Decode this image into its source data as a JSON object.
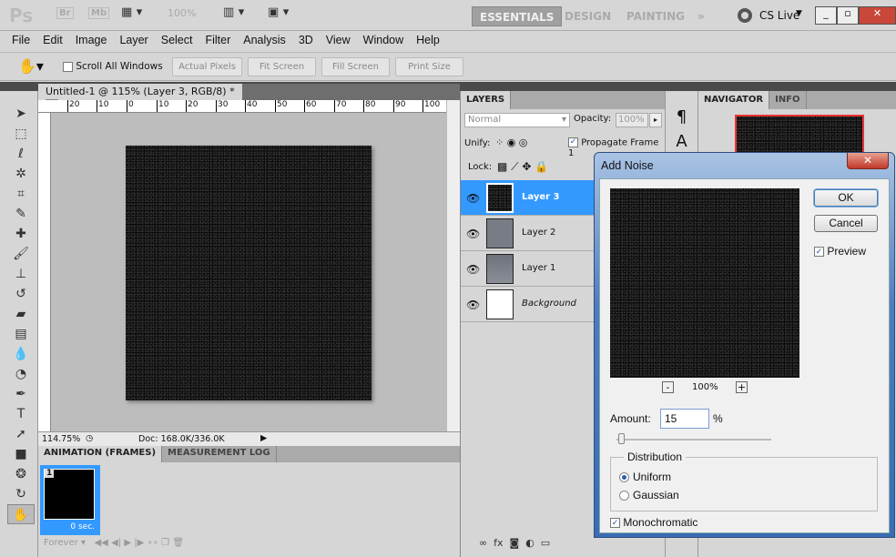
{
  "app": {
    "logo": "Ps",
    "bridge": "Br",
    "minibridge": "Mb",
    "zoom_display": "100%"
  },
  "workspaces": {
    "items": [
      "ESSENTIALS",
      "DESIGN",
      "PAINTING"
    ],
    "more": "»",
    "cslive": "CS Live"
  },
  "menu": [
    "File",
    "Edit",
    "Image",
    "Layer",
    "Select",
    "Filter",
    "Analysis",
    "3D",
    "View",
    "Window",
    "Help"
  ],
  "options": {
    "scroll_all": "Scroll All Windows",
    "buttons": [
      "Actual Pixels",
      "Fit Screen",
      "Fill Screen",
      "Print Size"
    ]
  },
  "document": {
    "tab_title": "Untitled-1 @ 115% (Layer 3, RGB/8) *",
    "ruler_labels": [
      "20",
      "10",
      "0",
      "10",
      "20",
      "30",
      "40",
      "50",
      "60",
      "70",
      "80",
      "90",
      "100"
    ],
    "zoom": "114.75%",
    "doc_info": "Doc: 168.0K/336.0K"
  },
  "animation": {
    "tabs": [
      "ANIMATION (FRAMES)",
      "MEASUREMENT LOG"
    ],
    "frame_number": "1",
    "frame_delay": "0 sec.",
    "loop": "Forever"
  },
  "layers": {
    "tab": "LAYERS",
    "blend_mode": "Normal",
    "opacity_label": "Opacity:",
    "opacity": "100%",
    "unify_label": "Unify:",
    "propagate": "Propagate Frame 1",
    "lock_label": "Lock:",
    "items": [
      {
        "name": "Layer 3",
        "selected": true
      },
      {
        "name": "Layer 2"
      },
      {
        "name": "Layer 1"
      },
      {
        "name": "Background"
      }
    ]
  },
  "navigator": {
    "tabs": [
      "NAVIGATOR",
      "INFO"
    ]
  },
  "dialog": {
    "title": "Add Noise",
    "ok": "OK",
    "cancel": "Cancel",
    "preview": "Preview",
    "preview_zoom": "100%",
    "amount_label": "Amount:",
    "amount": "15",
    "unit": "%",
    "distribution_label": "Distribution",
    "uniform": "Uniform",
    "gaussian": "Gaussian",
    "selected_distribution": "Uniform",
    "monochromatic": "Monochromatic"
  },
  "colors": {
    "selection": "#3399ff",
    "dialog_title": "#4d7cc0",
    "close": "#c0392b"
  }
}
